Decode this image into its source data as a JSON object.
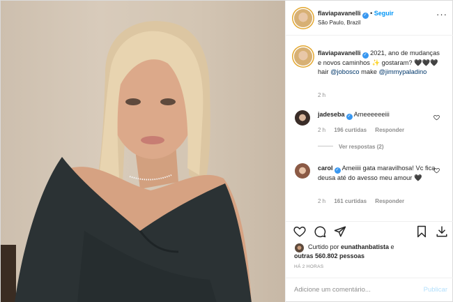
{
  "post": {
    "author": {
      "username": "flaviapavanelli",
      "location": "São Paulo, Brazil",
      "follow_label": "Seguir",
      "dot": "•"
    },
    "caption": {
      "username": "flaviapavanelli",
      "text_before": " 2021, ano de mudanças e novos caminhos ✨ gostaram? 🖤🖤🖤 hair ",
      "mention1": "@jobosco",
      "text_middle": " make ",
      "mention2": "@jimmypaladino",
      "time": "2 h"
    },
    "comments": [
      {
        "username": "jadeseba",
        "text": " Ameeeeeeiii",
        "time": "2 h",
        "likes": "196 curtidas",
        "reply": "Responder",
        "view_replies": "Ver respostas (2)"
      },
      {
        "username": "carol",
        "text": " Ameiiii gata maravilhosa! Vc fica deusa até do avesso meu amour 🖤",
        "time": "2 h",
        "likes": "161 curtidas",
        "reply": "Responder"
      }
    ],
    "likes": {
      "prefix": "Curtido por ",
      "user": "eunathanbatista",
      "middle": " e",
      "others": "outras 560.802 pessoas"
    },
    "timestamp": "HÁ 2 HORAS",
    "add_comment": {
      "placeholder": "Adicione um comentário...",
      "publish": "Publicar"
    },
    "icons": [
      "heart-icon",
      "comment-icon",
      "share-icon",
      "bookmark-icon",
      "more-icon",
      "verified-icon"
    ],
    "colors": {
      "accent": "#0095f6",
      "verified": "#3897f0",
      "muted": "#8e8e8e",
      "mention": "#00376b",
      "publish_disabled": "#b2dffc"
    }
  }
}
